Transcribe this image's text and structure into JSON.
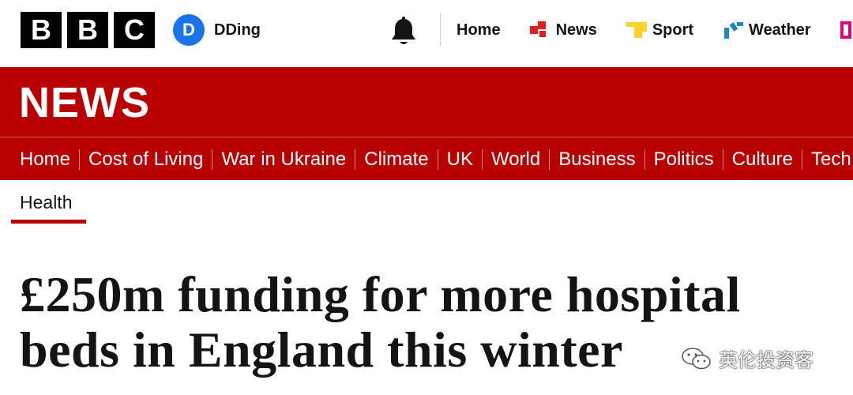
{
  "brand": {
    "logo_letters": [
      "B",
      "B",
      "C"
    ]
  },
  "account": {
    "avatar_initial": "D",
    "name": "DDing"
  },
  "topnav": {
    "items": [
      {
        "label": "Home",
        "icon": ""
      },
      {
        "label": "News",
        "icon": "news-icon"
      },
      {
        "label": "Sport",
        "icon": "sport-icon"
      },
      {
        "label": "Weather",
        "icon": "weather-icon"
      }
    ]
  },
  "banner": {
    "title": "NEWS"
  },
  "section_nav": {
    "items": [
      "Home",
      "Cost of Living",
      "War in Ukraine",
      "Climate",
      "UK",
      "World",
      "Business",
      "Politics",
      "Culture",
      "Tech"
    ]
  },
  "subnav": {
    "active": "Health"
  },
  "article": {
    "headline_line1": "£250m funding for more hospital",
    "headline_line2": "beds in England this winter"
  },
  "watermark": {
    "text": "英伦投资客"
  },
  "colors": {
    "bbc_red": "#b80000",
    "avatar_blue": "#1a73e8",
    "news_icon_red": "#e01e1e",
    "sport_yellow": "#ffd230",
    "weather_blue": "#1a86c8"
  }
}
